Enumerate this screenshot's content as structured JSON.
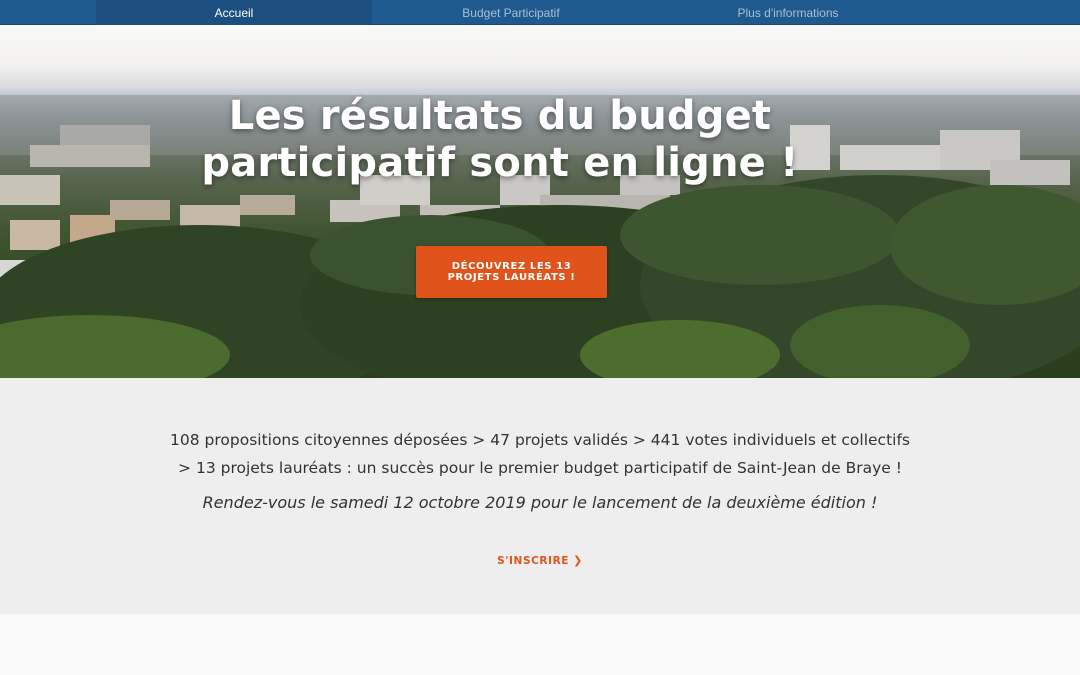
{
  "nav": {
    "items": [
      {
        "label": "Accueil"
      },
      {
        "label": "Budget Participatif"
      },
      {
        "label": "Plus d'informations"
      }
    ]
  },
  "hero": {
    "title": "Les résultats du budget participatif sont en ligne !",
    "cta_label": "DÉCOUVREZ LES 13 PROJETS LAURÉATS !"
  },
  "info": {
    "stats_line1": "108 propositions citoyennes déposées > 47 projets validés > 441 votes individuels et collectifs",
    "stats_line2": "> 13 projets lauréats : un succès pour le premier budget participatif de Saint-Jean de Braye !",
    "rdv": "Rendez-vous le samedi 12 octobre 2019 pour le lancement de la deuxième édition !",
    "signup_label": "S'INSCRIRE",
    "signup_icon": "chevron-right-icon"
  },
  "colors": {
    "nav_bg": "#1e5a8e",
    "accent": "#e0541c",
    "section_bg": "#eeeeee"
  }
}
